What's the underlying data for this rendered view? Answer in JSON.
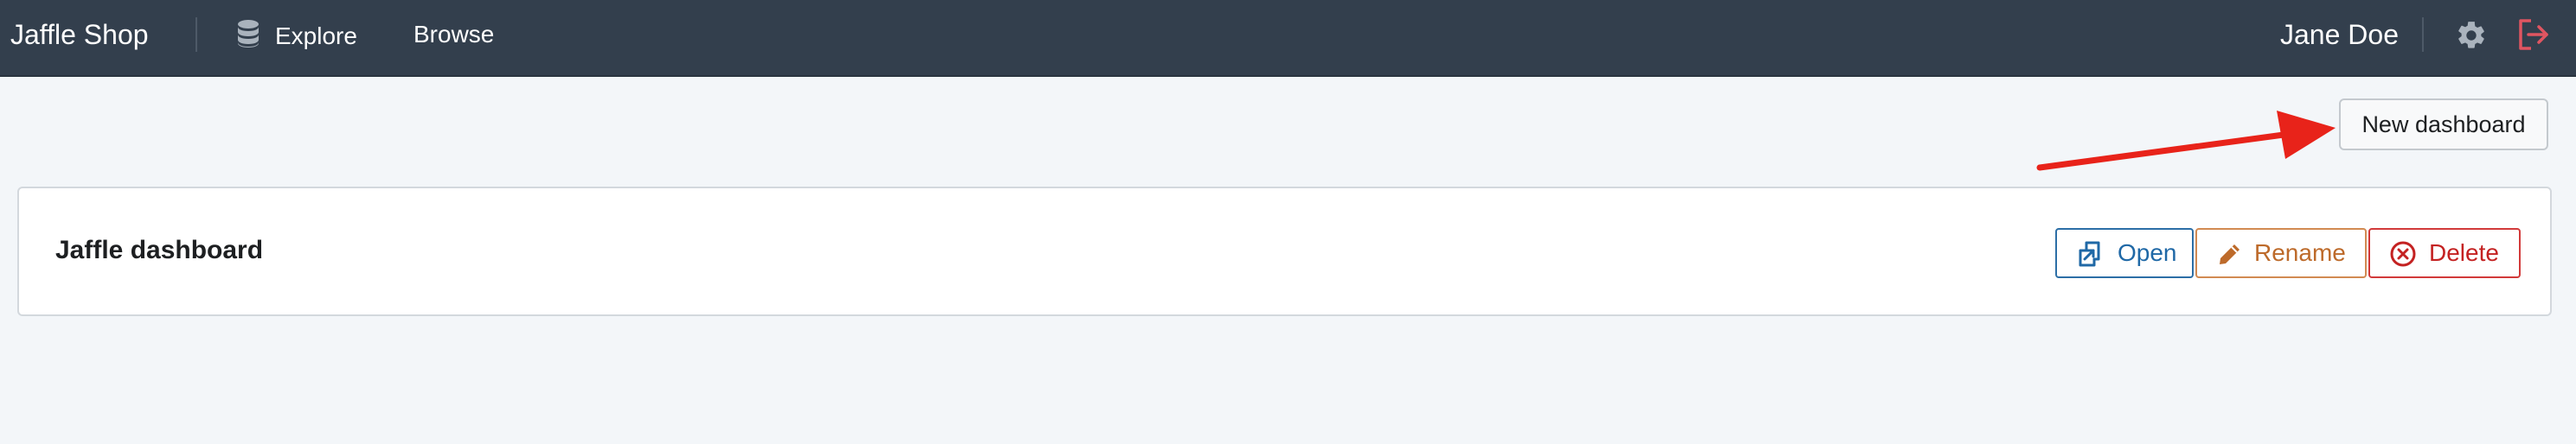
{
  "colors": {
    "navbar_bg": "#333f4d",
    "page_bg": "#f3f6f9",
    "open_accent": "#1f68a6",
    "rename_accent": "#bd6a2a",
    "delete_accent": "#c42222",
    "logout_icon": "#e05561",
    "annotation_arrow": "#e8231a"
  },
  "navbar": {
    "brand": "Jaffle Shop",
    "items": [
      {
        "label": "Explore",
        "icon": "database-icon"
      },
      {
        "label": "Browse"
      }
    ],
    "user_name": "Jane Doe",
    "settings_icon": "gear-icon",
    "logout_icon": "logout-icon"
  },
  "toolbar": {
    "new_dashboard_label": "New dashboard"
  },
  "dashboards": [
    {
      "title": "Jaffle dashboard",
      "actions": {
        "open": {
          "label": "Open",
          "icon": "open-external-icon"
        },
        "rename": {
          "label": "Rename",
          "icon": "pencil-icon"
        },
        "delete": {
          "label": "Delete",
          "icon": "circle-x-icon"
        }
      }
    }
  ]
}
